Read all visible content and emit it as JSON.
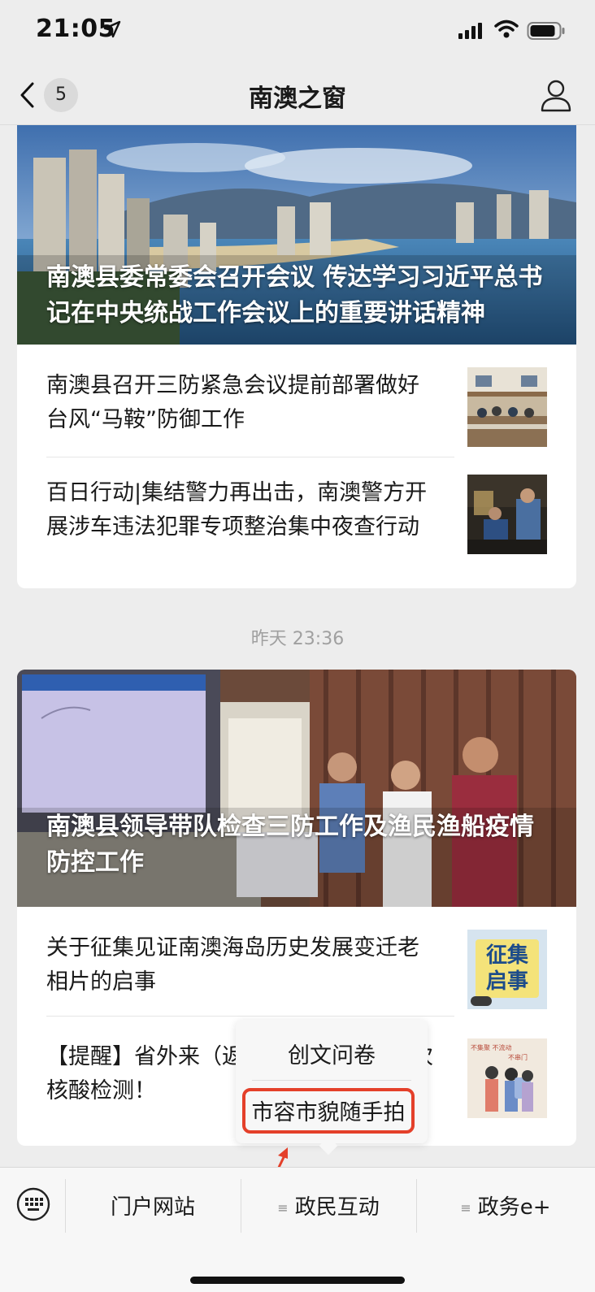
{
  "status_bar": {
    "time": "21:05"
  },
  "nav": {
    "back_count": "5",
    "title": "南澳之窗"
  },
  "card1": {
    "hero_title": "南澳县委常委会召开会议 传达学习习近平总书记在中央统战工作会议上的重要讲话精神",
    "articles": [
      {
        "title": "南澳县召开三防紧急会议提前部署做好台风“马鞍”防御工作"
      },
      {
        "title": "百日行动|集结警力再出击，南澳警方开展涉车违法犯罪专项整治集中夜查行动"
      }
    ]
  },
  "timestamp": "昨天 23:36",
  "card2": {
    "hero_title": "南澳县领导带队检查三防工作及渔民渔船疫情防控工作",
    "articles": [
      {
        "title": "关于征集见证南澳海岛历史发展变迁老相片的启事",
        "thumb_text": [
          "征集",
          "启事"
        ]
      },
      {
        "title": "【提醒】省外来（返）澳人员需完成2次核酸检测！",
        "thumb_text": [
          "不集聚",
          "不流动",
          "不串门"
        ]
      }
    ]
  },
  "popup_menu": {
    "items": [
      "创文问卷",
      "市容市貌随手拍"
    ],
    "highlight_color": "#e4402a"
  },
  "bottom_menu": {
    "items": [
      "门户网站",
      "政民互动",
      "政务e+"
    ],
    "submenu_marker": "≡"
  },
  "colors": {
    "background": "#ededed",
    "card": "#ffffff",
    "annotation": "#e4402a"
  }
}
